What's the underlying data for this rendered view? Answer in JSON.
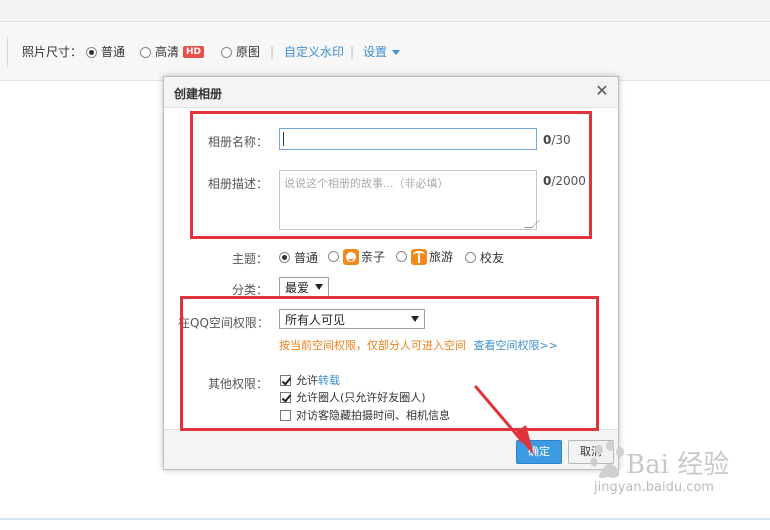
{
  "toolbar": {
    "size_label": "照片尺寸：",
    "opt_normal": "普通",
    "opt_hd": "高清",
    "hd_badge": "HD",
    "opt_original": "原图",
    "custom_watermark": "自定义水印",
    "separator": "|",
    "settings": "设置"
  },
  "dialog": {
    "title": "创建相册",
    "close_glyph": "✕",
    "name_label": "相册名称：",
    "name_value": "",
    "name_counter_num": "0",
    "name_counter_max": "/30",
    "desc_label": "相册描述：",
    "desc_placeholder": "说说这个相册的故事...（非必填）",
    "desc_counter_num": "0",
    "desc_counter_max": "/2000",
    "theme_label": "主题：",
    "themes": [
      "普通",
      "亲子",
      "旅游",
      "校友"
    ],
    "category_label": "分类：",
    "category_value": "最爱",
    "qzone_perm_label": "在QQ空间权限：",
    "qzone_perm_value": "所有人可见",
    "warning_text": "按当前空间权限，仅部分人可进入空间",
    "view_perm_link": "查看空间权限>>",
    "other_perm_label": "其他权限：",
    "allow_prefix": "允许",
    "allow_repost": "转载",
    "allow_circle": "允许圈人(只允许好友圈人)",
    "hide_exif": "对访客隐藏拍摄时间、相机信息",
    "ok_button": "确定",
    "cancel_button": "取消"
  },
  "watermark": {
    "text": "Bai 经验",
    "url": "jingyan.baidu.com"
  },
  "colors": {
    "accent_blue": "#3b9ae1",
    "link_blue": "#3e8fd0",
    "warning_orange": "#ef7f1a",
    "annotation_red": "#e1343a",
    "hd_badge_red": "#e8504a"
  }
}
